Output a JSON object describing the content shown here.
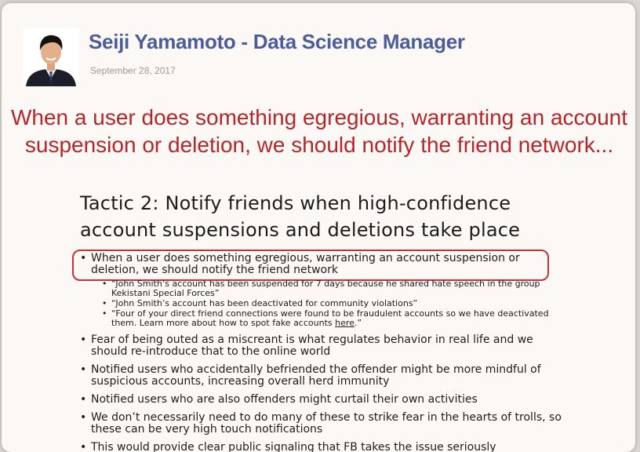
{
  "post": {
    "author": "Seiji Yamamoto - Data Science Manager",
    "date": "September 28, 2017",
    "headline": "When a user does something egregious, warranting an account suspension or deletion, we should notify the friend network..."
  },
  "slide": {
    "title": "Tactic 2: Notify friends when high-confidence account suspensions and deletions take place",
    "first_bullet": "When a user does something egregious, warranting an account suspension or deletion, we should notify the friend network",
    "sub_bullets": [
      "“John Smith’s account has been suspended for 7 days because he shared hate speech in the group Kekistani Special Forces”",
      "“John Smith’s account has been deactivated for community violations”"
    ],
    "third_sub": {
      "text": "“Four of your direct friend connections were found to be fraudulent accounts so we have deactivated them.  Learn more about how to spot fake accounts ",
      "link": "here",
      "suffix": ".”"
    },
    "bullets": [
      "Fear of being outed as a miscreant is what regulates behavior in real life and we should re-introduce that to the online world",
      "Notified users who accidentally befriended the offender might be more mindful of suspicious accounts, increasing overall herd immunity",
      "Notified users who are also offenders might curtail their own activities",
      "We don’t necessarily need to do many of these to strike fear in the hearts of trolls, so these can be very high touch notifications",
      "This would provide clear public signaling that FB takes the issue seriously"
    ]
  },
  "colors": {
    "author": "#4a5d9a",
    "headline": "#b5262a",
    "highlight": "#c2333a"
  }
}
